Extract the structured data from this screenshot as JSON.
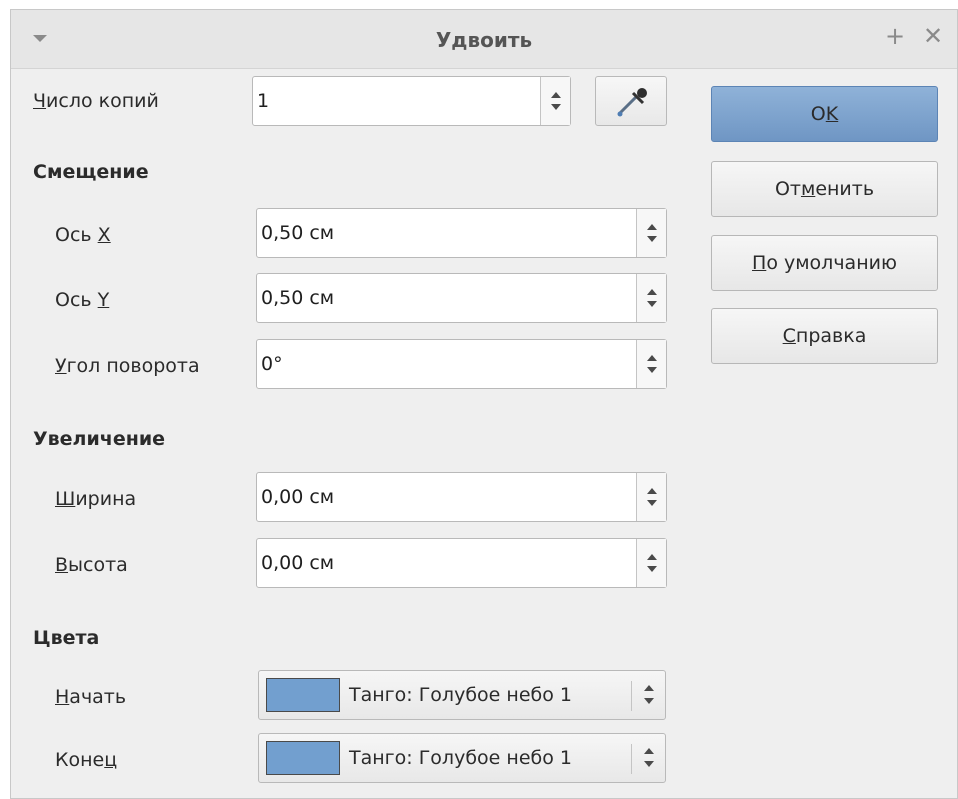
{
  "window": {
    "title": "Удвоить"
  },
  "copies": {
    "label_pre": "",
    "label_accel": "Ч",
    "label_post": "исло копий",
    "value": "1"
  },
  "offset": {
    "heading": "Смещение",
    "x": {
      "label_pre": "Ось ",
      "label_accel": "X",
      "label_post": "",
      "value": "0,50 см"
    },
    "y": {
      "label_pre": "Ось ",
      "label_accel": "Y",
      "label_post": "",
      "value": "0,50 см"
    },
    "angle": {
      "label_pre": "",
      "label_accel": "У",
      "label_post": "гол поворота",
      "value": "0°"
    }
  },
  "enlarge": {
    "heading": "Увеличение",
    "width": {
      "label_pre": "",
      "label_accel": "Ш",
      "label_post": "ирина",
      "value": "0,00 см"
    },
    "height": {
      "label_pre": "",
      "label_accel": "В",
      "label_post": "ысота",
      "value": "0,00 см"
    }
  },
  "colors": {
    "heading": "Цвета",
    "start": {
      "label_pre": "",
      "label_accel": "Н",
      "label_post": "ачать",
      "value": "Танго: Голубое небо 1",
      "swatch": "#729fcf"
    },
    "end": {
      "label_pre": "Коне",
      "label_accel": "ц",
      "label_post": "",
      "value": "Танго: Голубое небо 1",
      "swatch": "#729fcf"
    }
  },
  "buttons": {
    "ok": {
      "pre": "O",
      "accel": "K",
      "post": ""
    },
    "cancel": {
      "pre": "От",
      "accel": "м",
      "post": "енить"
    },
    "default": {
      "pre": "",
      "accel": "П",
      "post": "о умолчанию"
    },
    "help": {
      "pre": "",
      "accel": "С",
      "post": "правка"
    }
  }
}
